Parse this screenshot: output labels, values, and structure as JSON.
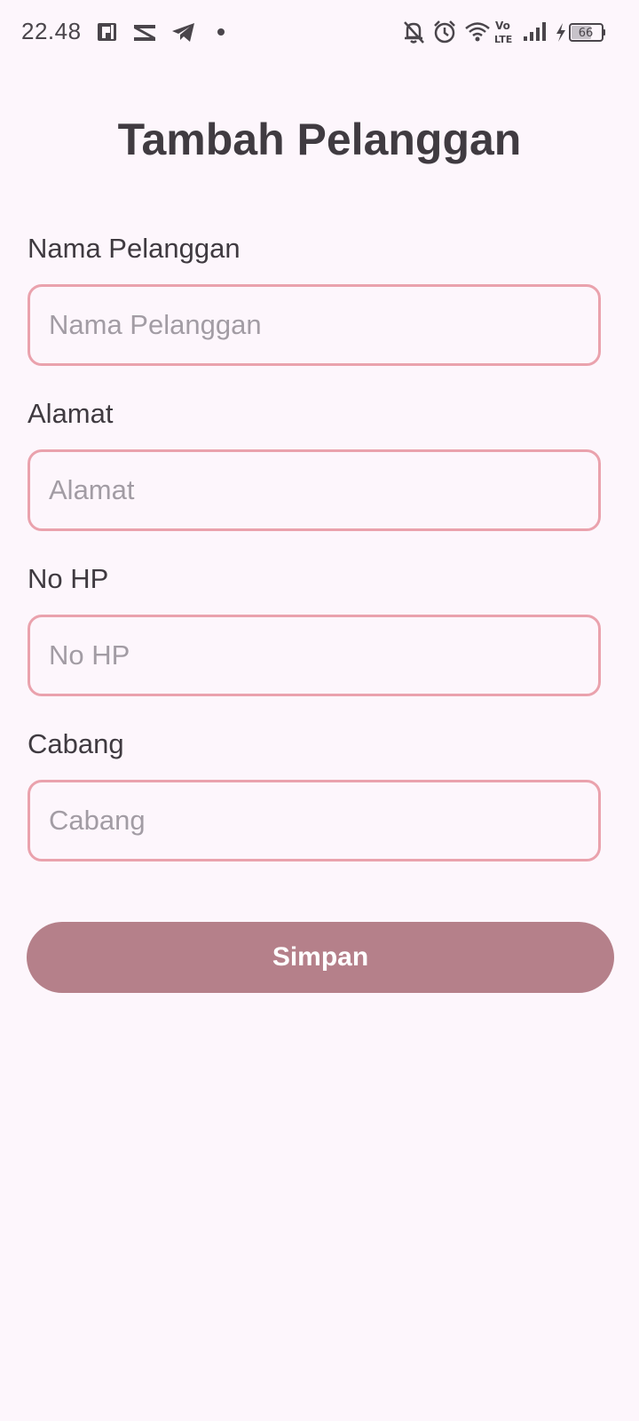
{
  "status_bar": {
    "time": "22.48",
    "battery_level": "66",
    "left_icons": [
      "parking-app-icon",
      "capcut-icon",
      "telegram-icon",
      "notification-dot-icon"
    ],
    "right_icons": [
      "bell-off-icon",
      "alarm-icon",
      "wifi-icon",
      "volte-icon",
      "signal-icon",
      "charging-icon",
      "battery-icon"
    ],
    "volte_top": "Vo",
    "volte_bottom": "LTE"
  },
  "page": {
    "title": "Tambah Pelanggan"
  },
  "form": {
    "fields": [
      {
        "label": "Nama Pelanggan",
        "placeholder": "Nama Pelanggan",
        "value": ""
      },
      {
        "label": "Alamat",
        "placeholder": "Alamat",
        "value": ""
      },
      {
        "label": "No HP",
        "placeholder": "No HP",
        "value": ""
      },
      {
        "label": "Cabang",
        "placeholder": "Cabang",
        "value": ""
      }
    ],
    "save_label": "Simpan"
  },
  "colors": {
    "background": "#fdf6fc",
    "input_border": "#eaa2ad",
    "button": "#b5808a",
    "title_text": "#403b41",
    "placeholder_text": "#a29ca4"
  }
}
